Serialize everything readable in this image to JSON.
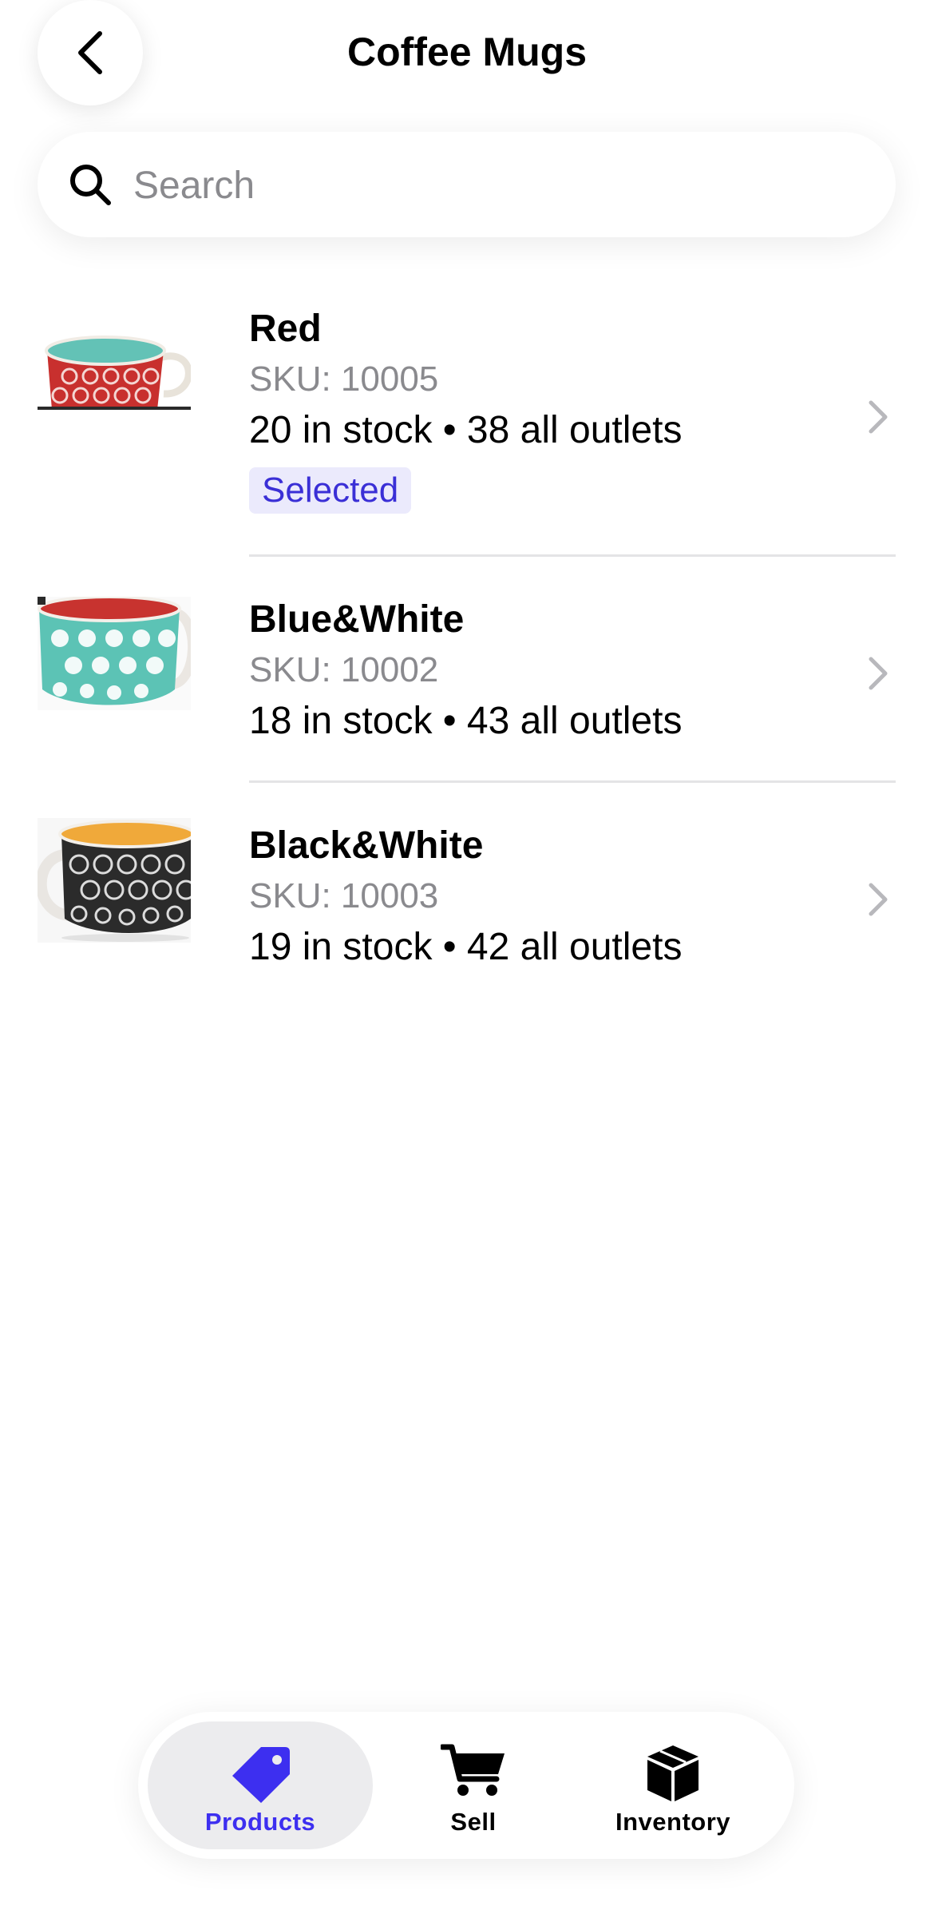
{
  "header": {
    "title": "Coffee Mugs",
    "back_icon": "chevron-left-icon"
  },
  "search": {
    "placeholder": "Search",
    "value": "",
    "icon": "search-icon"
  },
  "products": [
    {
      "name": "Red",
      "sku": "SKU: 10005",
      "stock": "20 in stock • 38 all outlets",
      "badge": "Selected"
    },
    {
      "name": "Blue&White",
      "sku": "SKU: 10002",
      "stock": "18 in stock • 43 all outlets"
    },
    {
      "name": "Black&White",
      "sku": "SKU: 10003",
      "stock": "19 in stock • 42 all outlets"
    }
  ],
  "tabbar": {
    "active": "Products",
    "accent": "#3d2ff0",
    "tabs": [
      {
        "label": "Products",
        "icon": "price-tag-icon"
      },
      {
        "label": "Sell",
        "icon": "shopping-cart-icon"
      },
      {
        "label": "Inventory",
        "icon": "box-icon"
      }
    ]
  },
  "colors": {
    "badge_bg": "#ebeafc",
    "badge_text": "#3a2fd6",
    "secondary_text": "#8a8a8e"
  }
}
